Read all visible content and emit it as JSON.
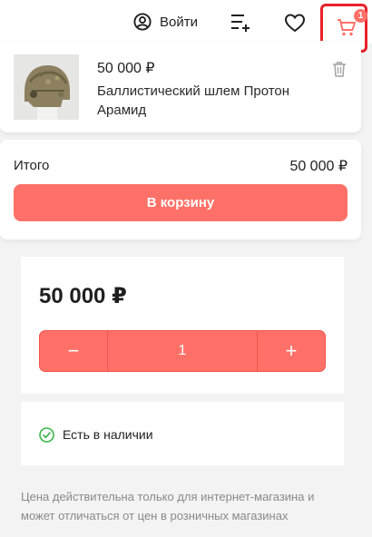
{
  "header": {
    "login_label": "Войти",
    "cart_count": "1",
    "icons": [
      "user-icon",
      "compare-icon",
      "heart-icon",
      "cart-icon"
    ],
    "accent_color": "#ff7168",
    "highlight_color": "#e8222a"
  },
  "mini_cart": {
    "item": {
      "price": "50 000 ₽",
      "name": "Баллистический шлем Протон Арамид"
    },
    "total_label": "Итого",
    "total_value": "50 000 ₽",
    "to_cart_label": "В корзину"
  },
  "product": {
    "price": "50 000 ₽",
    "quantity": "1",
    "minus_label": "−",
    "plus_label": "+",
    "stock_status": "Есть в наличии",
    "stock_color": "#3ab54a",
    "disclaimer": "Цена действительна только для интернет-магазина и может отличаться от цен в розничных магазинах"
  }
}
